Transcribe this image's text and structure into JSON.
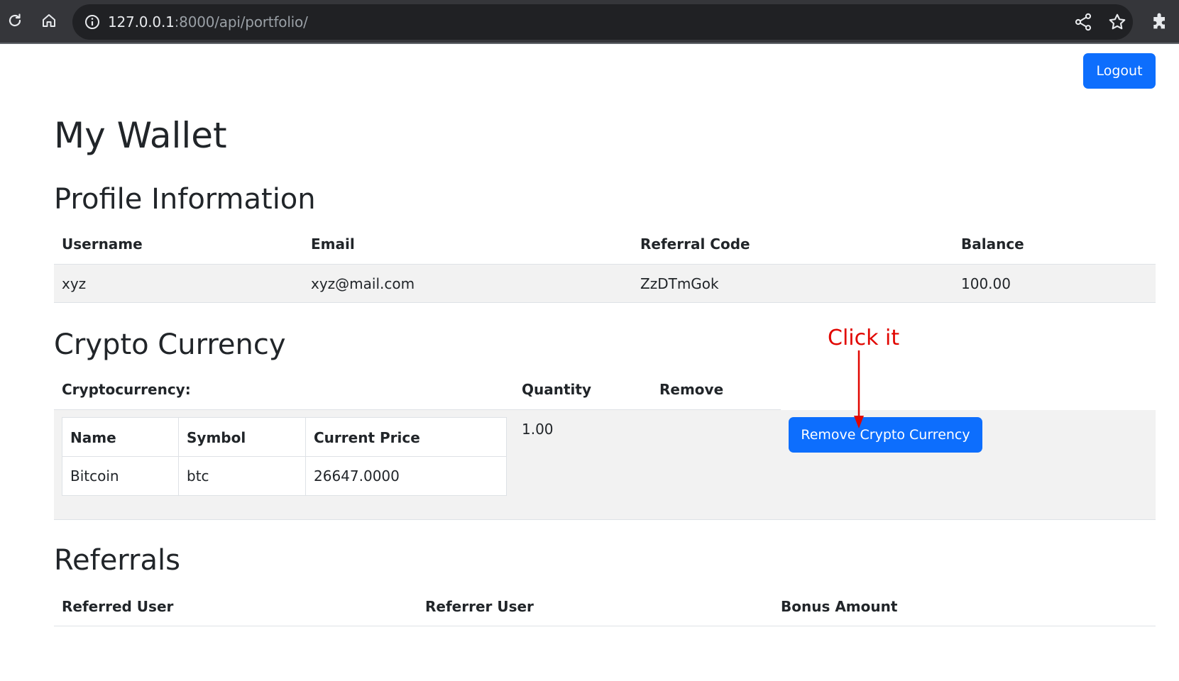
{
  "browser": {
    "url_host": "127.0.0.1",
    "url_path": ":8000/api/portfolio/"
  },
  "header": {
    "logout_label": "Logout"
  },
  "page": {
    "title": "My Wallet"
  },
  "profile": {
    "title": "Profile Information",
    "columns": [
      "Username",
      "Email",
      "Referral Code",
      "Balance"
    ],
    "row": {
      "username": "xyz",
      "email": "xyz@mail.com",
      "referral_code": "ZzDTmGok",
      "balance": "100.00"
    }
  },
  "crypto": {
    "title": "Crypto Currency",
    "columns": [
      "Cryptocurrency:",
      "Quantity",
      "Remove"
    ],
    "inner_columns": [
      "Name",
      "Symbol",
      "Current Price"
    ],
    "item": {
      "name": "Bitcoin",
      "symbol": "btc",
      "current_price": "26647.0000",
      "quantity": "1.00"
    },
    "remove_label": "Remove Crypto Currency"
  },
  "annotation": {
    "text": "Click it",
    "color": "#e10600"
  },
  "referrals": {
    "title": "Referrals",
    "columns": [
      "Referred User",
      "Referrer User",
      "Bonus Amount"
    ]
  },
  "colors": {
    "primary": "#0d6efd",
    "row_background": "#f2f2f2",
    "browser_bar": "#35363a"
  }
}
